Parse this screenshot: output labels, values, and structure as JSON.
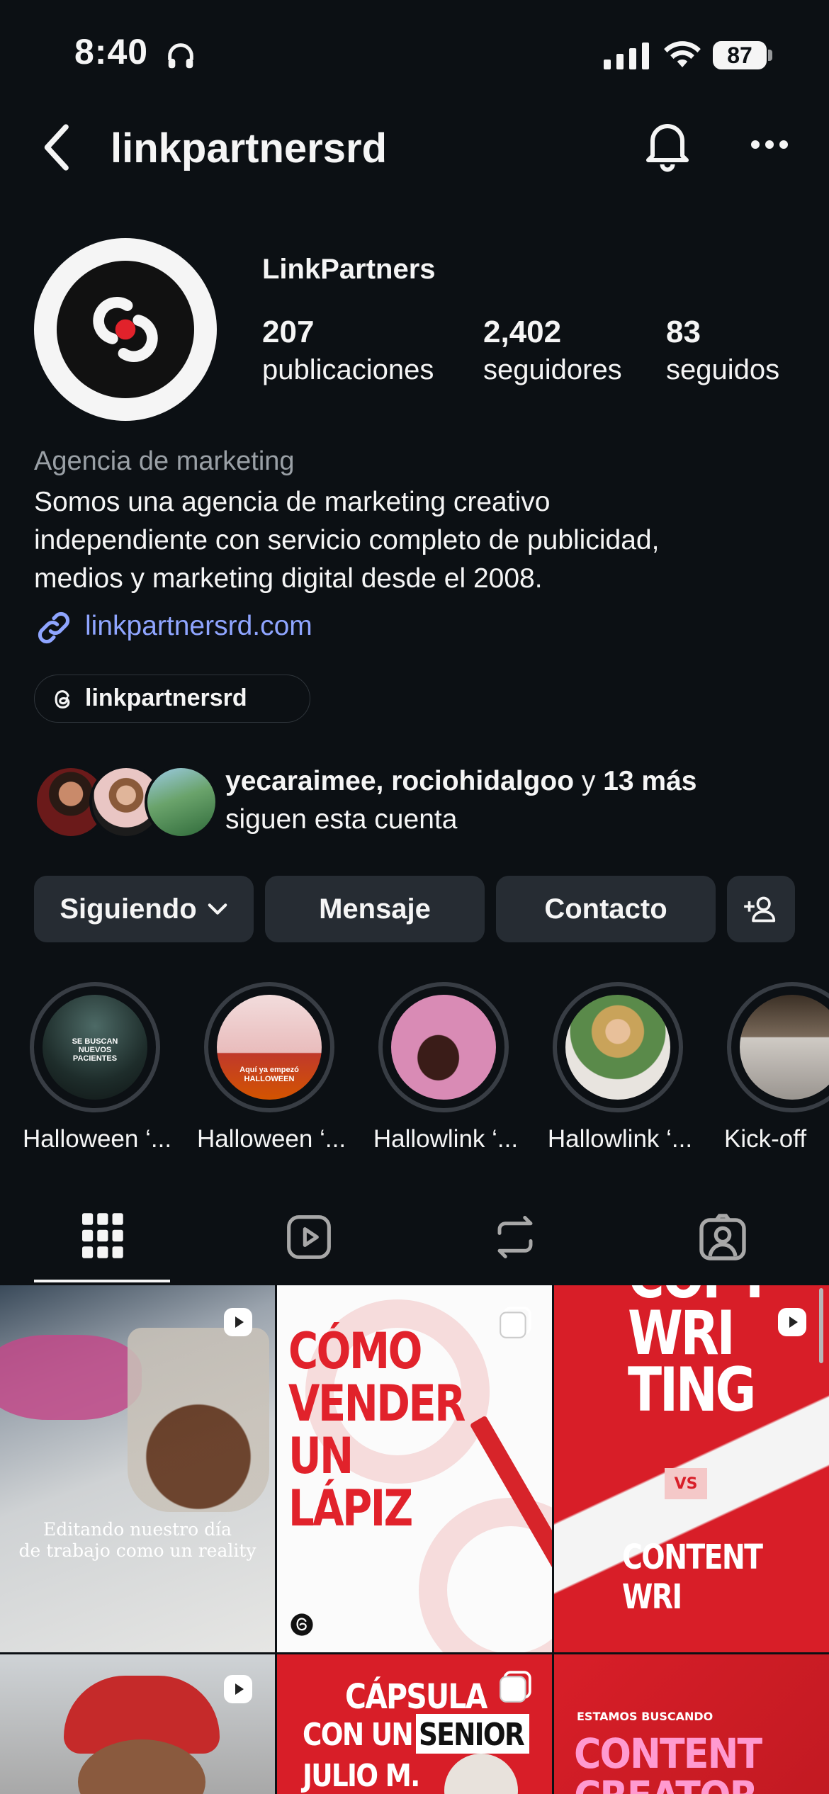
{
  "status_bar": {
    "time": "8:40",
    "battery": "87"
  },
  "header": {
    "username": "linkpartnersrd"
  },
  "profile": {
    "display_name": "LinkPartners",
    "stats": [
      {
        "value": "207",
        "label": "publicaciones"
      },
      {
        "value": "2,402",
        "label": "seguidores"
      },
      {
        "value": "83",
        "label": "seguidos"
      }
    ],
    "category": "Agencia de marketing",
    "bio_lines": [
      "Somos una agencia de marketing creativo",
      "independiente con servicio completo de publicidad,",
      "medios y marketing digital desde el 2008."
    ],
    "website": "linkpartnersrd.com",
    "threads_handle": "linkpartnersrd",
    "followed_by": {
      "names": "yecaraimee, rociohidalgoo",
      "connector": " y ",
      "more": "13 más",
      "suffix": "siguen esta cuenta"
    }
  },
  "actions": {
    "following": "Siguiendo",
    "message": "Mensaje",
    "contact": "Contacto"
  },
  "highlights": [
    {
      "label": "Halloween ‘...",
      "img_text": "SE BUSCAN\nNUEVOS\nPACIENTES"
    },
    {
      "label": "Halloween ‘...",
      "img_text": "Aquí ya empezó\nHALLOWEEN"
    },
    {
      "label": "Hallowlink ‘..."
    },
    {
      "label": "Hallowlink ‘..."
    },
    {
      "label": "Kick-off"
    }
  ],
  "posts": [
    {
      "caption": "Editando nuestro día\nde trabajo como un reality"
    },
    {
      "caption": "CÓMO\nVENDER\nUN\nLÁPIZ"
    },
    {
      "top": "COPY\nWRI\nTING",
      "vs": "VS",
      "bottom": "CONTENT\nWRI"
    },
    {
      "caption": ""
    },
    {
      "top": "CÁPSULA",
      "mid": "CON UN",
      "highlight": "SENIOR",
      "bottom": "JULIO M."
    },
    {
      "small": "ESTAMOS BUSCANDO",
      "big": "CONTENT\nCREATOR"
    }
  ],
  "colors": {
    "accent_link": "#8fa5ff",
    "brand_red": "#e1222b",
    "bg": "#0c1014"
  }
}
